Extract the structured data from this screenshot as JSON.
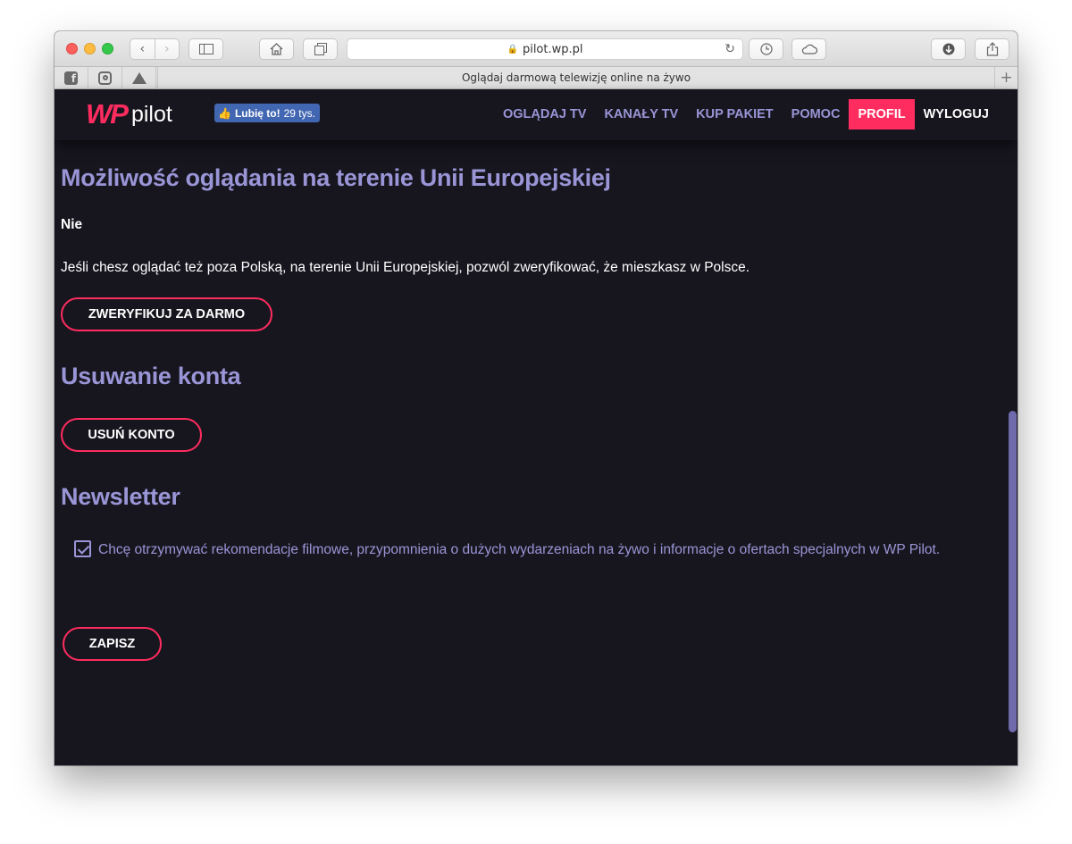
{
  "browser": {
    "url": "pilot.wp.pl",
    "tab_title": "Oglądaj darmową telewizję online na żywo",
    "new_tab": "+"
  },
  "header": {
    "logo_mark": "WP",
    "logo_text": "pilot",
    "fb_like": {
      "label": "Lubię to!",
      "count": "29 tys."
    },
    "nav": {
      "watch_tv": "OGLĄDAJ TV",
      "channels": "KANAŁY TV",
      "buy_package": "KUP PAKIET",
      "help": "POMOC",
      "profile": "PROFIL",
      "logout": "WYLOGUJ"
    }
  },
  "eu_section": {
    "title": "Możliwość oglądania na terenie Unii Europejskiej",
    "status": "Nie",
    "description": "Jeśli chesz oglądać też poza Polską, na terenie Unii Europejskiej, pozwól zweryfikować, że mieszkasz w Polsce.",
    "button": "ZWERYFIKUJ ZA DARMO"
  },
  "account_section": {
    "title": "Usuwanie konta",
    "button": "USUŃ KONTO"
  },
  "newsletter_section": {
    "title": "Newsletter",
    "checkbox_label": "Chcę otrzymywać rekomendacje filmowe, przypomnienia o dużych wydarzeniach na żywo i informacje o ofertach specjalnych w WP Pilot.",
    "checked": true,
    "button": "ZAPISZ"
  },
  "colors": {
    "accent": "#ff2c5f",
    "lavender": "#9a95d6",
    "background": "#17161f"
  }
}
